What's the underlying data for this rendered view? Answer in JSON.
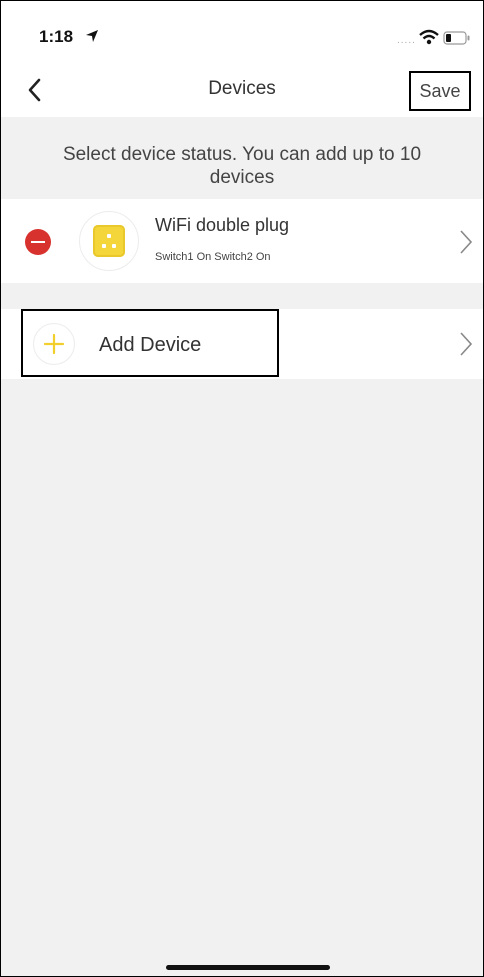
{
  "status_bar": {
    "time": "1:18",
    "icons": [
      "location-arrow-icon",
      "cellular-dots-icon",
      "wifi-icon",
      "battery-icon"
    ],
    "signal_dots": "....."
  },
  "nav": {
    "title": "Devices",
    "back_icon": "chevron-left-icon",
    "save_label": "Save"
  },
  "hint_text": "Select device status. You can add up to 10 devices",
  "devices": [
    {
      "name": "WiFi double plug",
      "status": "Switch1 On Switch2 On",
      "icon": "plug-icon",
      "remove_icon": "remove-circle-icon",
      "chevron_icon": "chevron-right-icon"
    }
  ],
  "add_device": {
    "label": "Add Device",
    "icon": "plus-icon",
    "chevron_icon": "chevron-right-icon"
  },
  "colors": {
    "accent_yellow": "#f4d63a",
    "remove_red": "#d8322e",
    "background": "#f1f1f1"
  }
}
